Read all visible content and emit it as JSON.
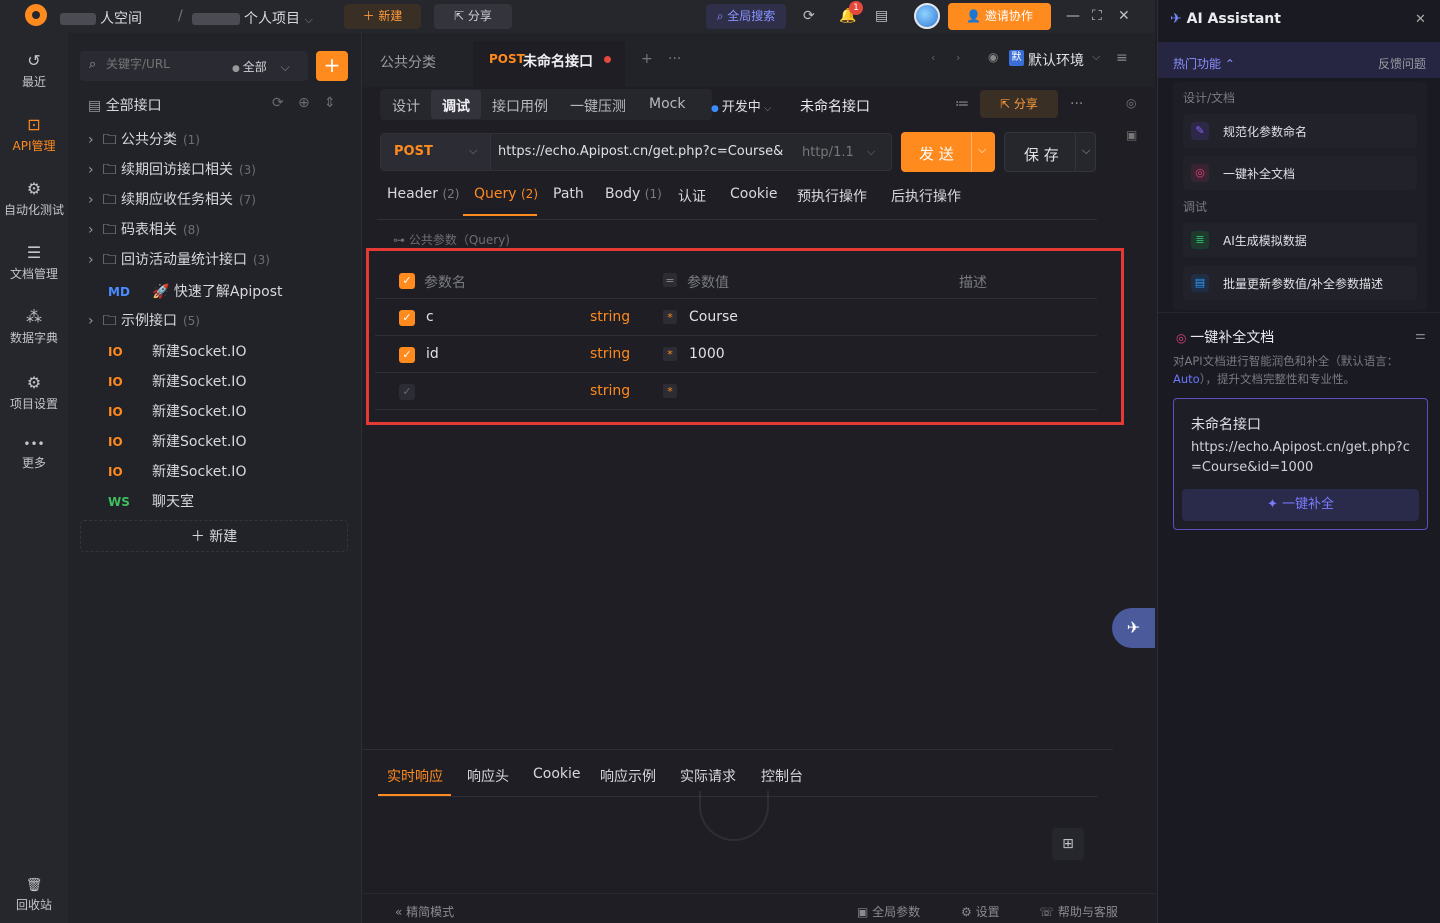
{
  "topbar": {
    "workspace": "人空间",
    "separator": "/",
    "project": "个人项目",
    "new_label": "新建",
    "share_label": "分享",
    "global_search": "全局搜索",
    "notification_count": "1",
    "invite_label": "邀请协作"
  },
  "nav": [
    {
      "label": "最近",
      "icon": "history-icon",
      "glyph": "↺"
    },
    {
      "label": "API管理",
      "icon": "api-icon",
      "glyph": "⊡"
    },
    {
      "label": "自动化测试",
      "icon": "automation-icon",
      "glyph": "⚙"
    },
    {
      "label": "文档管理",
      "icon": "document-icon",
      "glyph": "☰"
    },
    {
      "label": "数据字典",
      "icon": "dictionary-icon",
      "glyph": "⁂"
    },
    {
      "label": "项目设置",
      "icon": "project-settings-icon",
      "glyph": "⚙"
    },
    {
      "label": "更多",
      "icon": "more-icon",
      "glyph": "•••"
    },
    {
      "label": "回收站",
      "icon": "trash-icon",
      "glyph": "🗑"
    }
  ],
  "tree": {
    "search_placeholder": "关键字/URL",
    "filter": "全部",
    "root_label": "全部接口",
    "folders": [
      {
        "label": "公共分类",
        "count": "(1)"
      },
      {
        "label": "续期回访接口相关",
        "count": "(3)"
      },
      {
        "label": "续期应收任务相关",
        "count": "(7)"
      },
      {
        "label": "码表相关",
        "count": "(8)"
      },
      {
        "label": "回访活动量统计接口",
        "count": "(3)"
      }
    ],
    "md_item": {
      "tag": "MD",
      "label": "快速了解Apipost"
    },
    "example_folder": {
      "label": "示例接口",
      "count": "(5)"
    },
    "socket_items": [
      {
        "tag": "IO",
        "label": "新建Socket.IO"
      },
      {
        "tag": "IO",
        "label": "新建Socket.IO"
      },
      {
        "tag": "IO",
        "label": "新建Socket.IO"
      },
      {
        "tag": "IO",
        "label": "新建Socket.IO"
      },
      {
        "tag": "IO",
        "label": "新建Socket.IO"
      }
    ],
    "ws_item": {
      "tag": "WS",
      "label": "聊天室"
    },
    "new_label": "新建"
  },
  "main": {
    "tabs": {
      "public": "公共分类",
      "active_method": "POST",
      "active_name": "未命名接口"
    },
    "env_badge": "默",
    "env_label": "默认环境",
    "subtabs": [
      "设计",
      "调试",
      "接口用例",
      "一键压测",
      "Mock"
    ],
    "active_subtab": "调试",
    "status": "开发中",
    "api_name": "未命名接口",
    "share_label": "分享",
    "method": "POST",
    "url": "https://echo.Apipost.cn/get.php?c=Course&ic",
    "protocol": "http/1.1",
    "send_label": "发 送",
    "save_label": "保 存",
    "req_tabs": [
      {
        "label": "Header",
        "count": "(2)"
      },
      {
        "label": "Query",
        "count": "(2)"
      },
      {
        "label": "Path",
        "count": ""
      },
      {
        "label": "Body",
        "count": "(1)"
      },
      {
        "label": "认证",
        "count": ""
      },
      {
        "label": "Cookie",
        "count": ""
      },
      {
        "label": "预执行操作",
        "count": ""
      },
      {
        "label": "后执行操作",
        "count": ""
      }
    ],
    "public_params": "公共参数（Query)",
    "params_header": {
      "name": "参数名",
      "value": "参数值",
      "desc": "描述"
    },
    "params": [
      {
        "name": "c",
        "type": "string",
        "value": "Course",
        "checked": true
      },
      {
        "name": "id",
        "type": "string",
        "value": "1000",
        "checked": true
      },
      {
        "name": "",
        "type": "string",
        "value": "",
        "checked": false
      }
    ],
    "resp_tabs": [
      "实时响应",
      "响应头",
      "Cookie",
      "响应示例",
      "实际请求",
      "控制台"
    ],
    "footer": {
      "mode": "精简模式",
      "global_params": "全局参数",
      "settings": "设置",
      "help": "帮助与客服"
    }
  },
  "ai": {
    "title": "AI Assistant",
    "hot_label": "热门功能",
    "feedback": "反馈问题",
    "sec_design": "设计/文档",
    "sec_debug": "调试",
    "cards": [
      {
        "label": "规范化参数命名",
        "icon": "rename-icon",
        "color": "#8a63ff"
      },
      {
        "label": "一键补全文档",
        "icon": "complete-doc-icon",
        "color": "#e0407a"
      },
      {
        "label": "AI生成模拟数据",
        "icon": "mock-data-icon",
        "color": "#2fbf71"
      },
      {
        "label": "批量更新参数值/补全参数描述",
        "icon": "batch-update-icon",
        "color": "#2f9bff"
      }
    ],
    "feature_title": "一键补全文档",
    "feature_desc": "对API文档进行智能润色和补全（默认语言：",
    "feature_desc_link": "Auto",
    "feature_desc_tail": "），提升文档完整性和专业性。",
    "input_title": "未命名接口",
    "input_url": "https://echo.Apipost.cn/get.php?c=Course&id=1000",
    "run_label": "一键补全"
  }
}
